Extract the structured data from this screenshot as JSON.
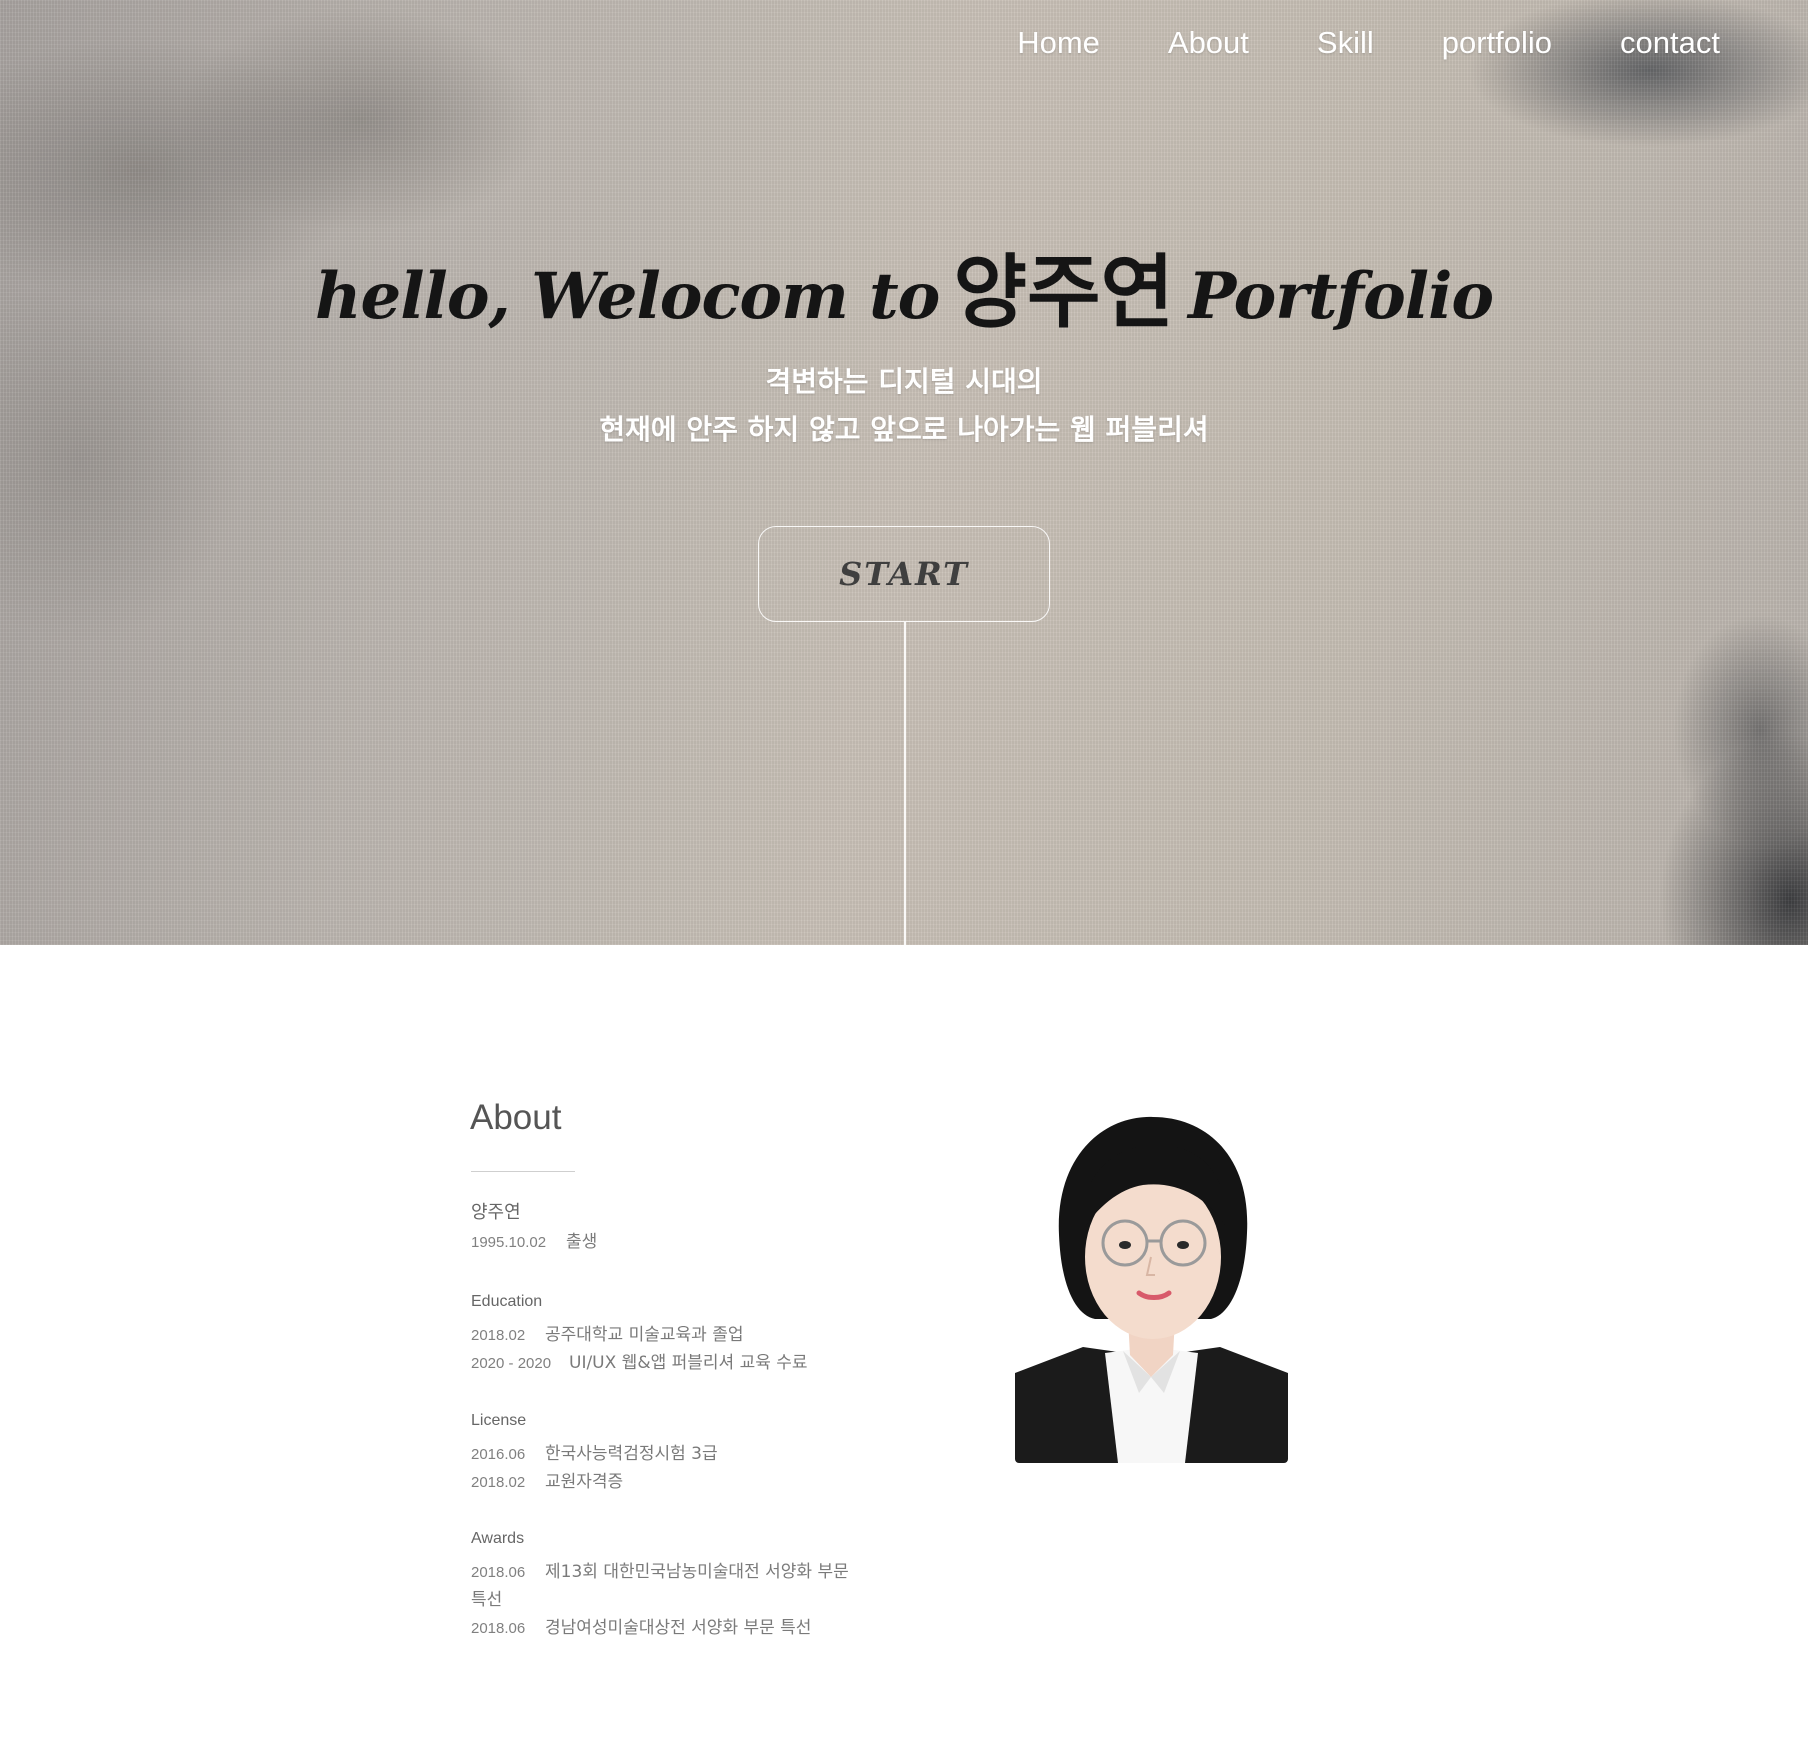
{
  "nav": {
    "items": [
      "Home",
      "About",
      "Skill",
      "portfolio",
      "contact"
    ]
  },
  "hero": {
    "title_pre": "hello, Welocom to",
    "title_name": "양주연",
    "title_post": "Portfolio",
    "subtitle_line1": "격변하는 디지털 시대의",
    "subtitle_line2": "현재에 안주 하지 않고 앞으로 나아가는 웹 퍼블리셔",
    "start_label": "START"
  },
  "about": {
    "title": "About",
    "name": "양주연",
    "birth": {
      "date": "1995.10.02",
      "label": "출생"
    },
    "education": {
      "heading": "Education",
      "items": [
        {
          "date": "2018.02",
          "text": "공주대학교 미술교육과 졸업"
        },
        {
          "date": "2020 - 2020",
          "text": "UI/UX 웹&앱 퍼블리셔 교육 수료"
        }
      ]
    },
    "license": {
      "heading": "License",
      "items": [
        {
          "date": "2016.06",
          "text": "한국사능력검정시험 3급"
        },
        {
          "date": "2018.02",
          "text": "교원자격증"
        }
      ]
    },
    "awards": {
      "heading": "Awards",
      "items": [
        {
          "date": "2018.06",
          "text": "제13회 대한민국남농미술대전 서양화 부문",
          "text_cont": "특선"
        },
        {
          "date": "2018.06",
          "text": "경남여성미술대상전 서양화 부문 특선"
        }
      ]
    }
  },
  "colors": {
    "nav_text": "#ffffff",
    "title_text": "#151515",
    "body_text": "#7a7a7a"
  }
}
